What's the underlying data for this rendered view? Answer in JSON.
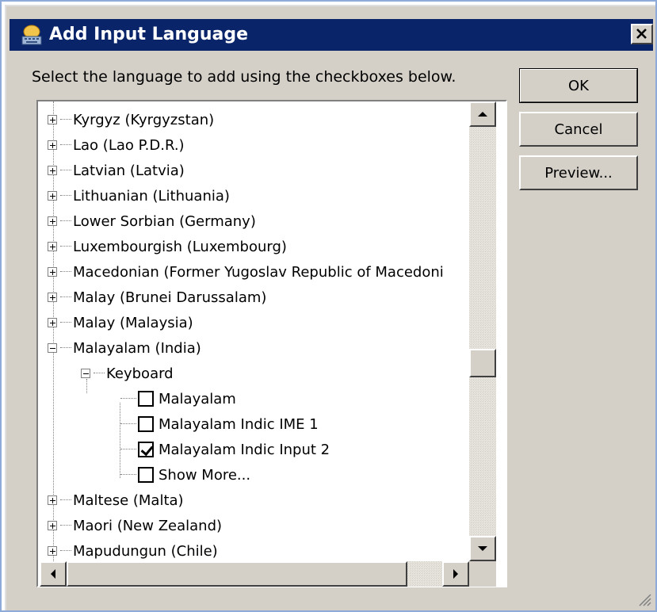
{
  "dialog": {
    "title": "Add Input Language",
    "title_icon": "keyboard-globe-icon",
    "instruction": "Select the language to add using the checkboxes below.",
    "buttons": {
      "ok": "OK",
      "cancel": "Cancel",
      "preview": "Preview..."
    }
  },
  "tree": {
    "languages_before": [
      "Kyrgyz (Kyrgyzstan)",
      "Lao (Lao P.D.R.)",
      "Latvian (Latvia)",
      "Lithuanian (Lithuania)",
      "Lower Sorbian (Germany)",
      "Luxembourgish (Luxembourg)",
      "Macedonian (Former Yugoslav Republic of Macedoni",
      "Malay (Brunei Darussalam)",
      "Malay (Malaysia)"
    ],
    "expanded_language": "Malayalam (India)",
    "group": "Keyboard",
    "layouts": [
      {
        "label": "Malayalam",
        "checked": false
      },
      {
        "label": "Malayalam Indic IME 1",
        "checked": false
      },
      {
        "label": "Malayalam Indic Input 2",
        "checked": true
      },
      {
        "label": "Show More...",
        "checked": false
      }
    ],
    "languages_after": [
      "Maltese (Malta)",
      "Maori (New Zealand)",
      "Mapudungun (Chile)"
    ]
  },
  "colors": {
    "titlebar": "#0a246a",
    "face": "#d4d0c8"
  }
}
